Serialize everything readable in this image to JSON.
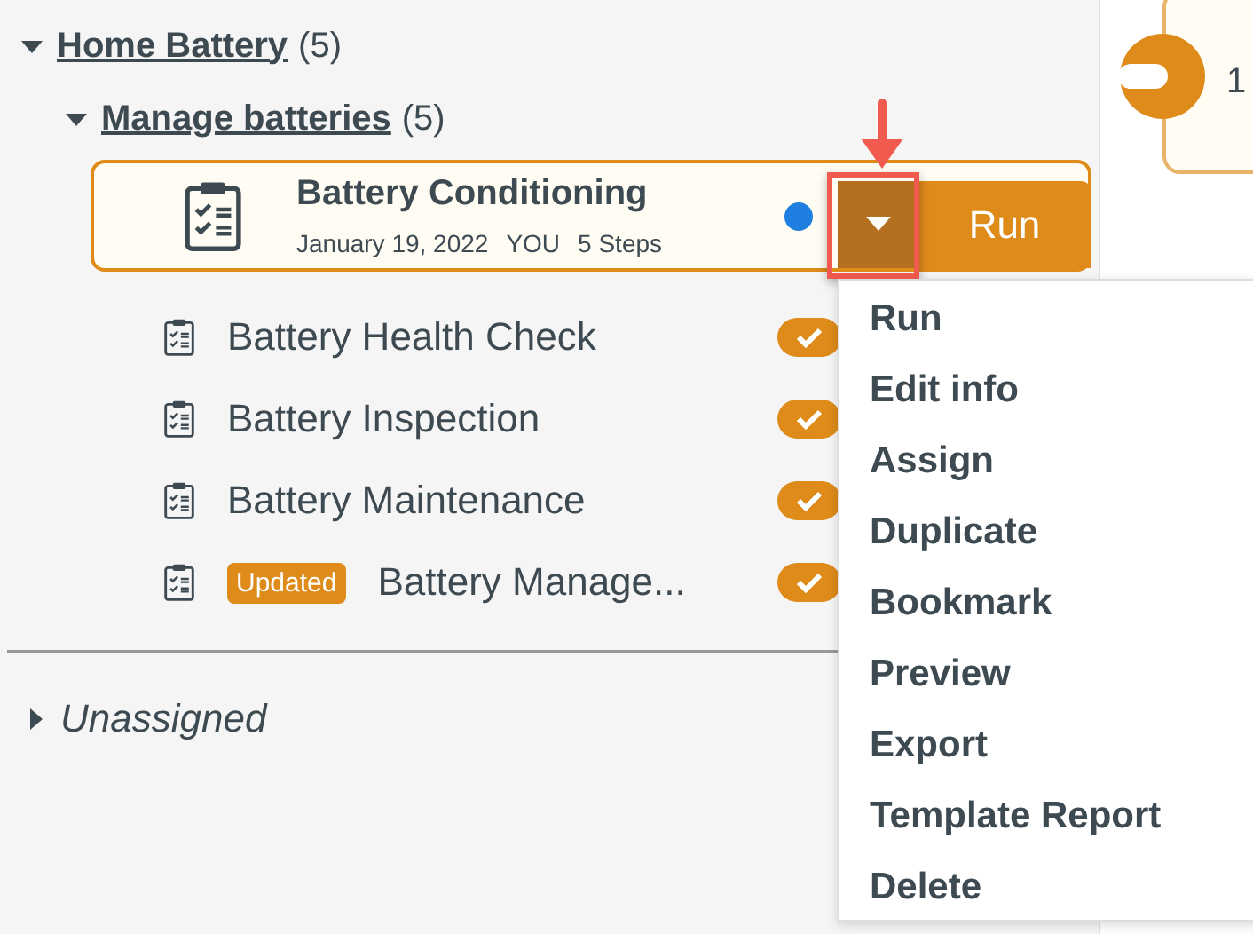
{
  "tree": {
    "label": "Home Battery",
    "count": "(5)",
    "expanded": true,
    "children": [
      {
        "label": "Manage batteries",
        "count": "(5)",
        "expanded": true,
        "items": [
          {
            "title": "Battery Conditioning",
            "date": "January 19, 2022",
            "owner": "YOU",
            "steps": "5 Steps",
            "selected": true,
            "unread": true,
            "run_label": "Run"
          },
          {
            "title": "Battery Health Check",
            "selected": false,
            "checked": true
          },
          {
            "title": "Battery Inspection",
            "selected": false,
            "checked": true
          },
          {
            "title": "Battery Maintenance",
            "selected": false,
            "checked": true
          },
          {
            "title": "Battery Manage...",
            "badge": "Updated",
            "selected": false,
            "checked": true
          }
        ]
      }
    ]
  },
  "unassigned": {
    "label": "Unassigned",
    "expanded": false
  },
  "menu": {
    "items": [
      "Run",
      "Edit info",
      "Assign",
      "Duplicate",
      "Bookmark",
      "Preview",
      "Export",
      "Template Report",
      "Delete"
    ]
  },
  "side_card": {
    "text": "1"
  }
}
